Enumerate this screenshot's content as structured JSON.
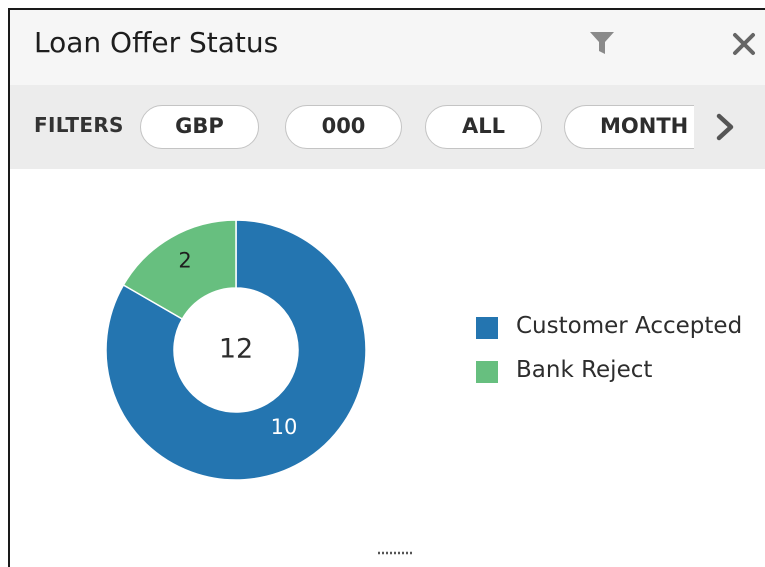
{
  "widget": {
    "title": "Loan Offer Status",
    "filter_icon": "filter-icon",
    "close_icon": "close-icon"
  },
  "filters": {
    "label": "FILTERS",
    "chips": [
      "GBP",
      "000",
      "ALL",
      "MONTH"
    ],
    "scroll_icon": "chevron-right-icon"
  },
  "chart_data": {
    "type": "pie",
    "style": "donut",
    "total": 12,
    "slices": [
      {
        "name": "Customer Accepted",
        "value": 10,
        "color": "#2475b0"
      },
      {
        "name": "Bank Reject",
        "value": 2,
        "color": "#67bf7f"
      }
    ],
    "legend_position": "right"
  },
  "footer": {
    "resize_handle_icon": "drag-handle-icon"
  }
}
